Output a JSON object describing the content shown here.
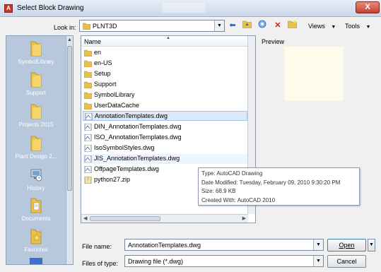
{
  "window": {
    "title": "Select Block Drawing",
    "close_glyph": "X"
  },
  "places": [
    {
      "label": "SymbolLibrary",
      "icon": "folder-icon"
    },
    {
      "label": "Support",
      "icon": "folder-icon"
    },
    {
      "label": "Projects 2015",
      "icon": "folder-icon"
    },
    {
      "label": "Plant Design 2...",
      "icon": "folder-icon"
    },
    {
      "label": "History",
      "icon": "history-icon"
    },
    {
      "label": "Documents",
      "icon": "documents-icon"
    },
    {
      "label": "Favorites",
      "icon": "favorites-icon"
    }
  ],
  "toolbar": {
    "look_in_label": "Look in:",
    "look_in_value": "PLNT3D",
    "views_label": "Views",
    "tools_label": "Tools"
  },
  "file_list": {
    "header": "Name",
    "items": [
      {
        "name": "en",
        "kind": "folder"
      },
      {
        "name": "en-US",
        "kind": "folder"
      },
      {
        "name": "Setup",
        "kind": "folder"
      },
      {
        "name": "Support",
        "kind": "folder"
      },
      {
        "name": "SymbolLibrary",
        "kind": "folder"
      },
      {
        "name": "UserDataCache",
        "kind": "folder"
      },
      {
        "name": "AnnotationTemplates.dwg",
        "kind": "dwg",
        "selected": true
      },
      {
        "name": "DIN_AnnotationTemplates.dwg",
        "kind": "dwg"
      },
      {
        "name": "ISO_AnnotationTemplates.dwg",
        "kind": "dwg"
      },
      {
        "name": "IsoSymbolStyles.dwg",
        "kind": "dwg"
      },
      {
        "name": "JIS_AnnotationTemplates.dwg",
        "kind": "dwg",
        "hover": true
      },
      {
        "name": "OffpageTemplates.dwg",
        "kind": "dwg"
      },
      {
        "name": "python27.zip",
        "kind": "zip"
      }
    ]
  },
  "tooltip": {
    "type": "Type: AutoCAD Drawing",
    "modified": "Date Modified: Tuesday, February 09, 2010 9:30:20 PM",
    "size": "Size: 68.9 KB",
    "created_with": "Created With: AutoCAD 2010"
  },
  "preview": {
    "label": "Preview"
  },
  "footer": {
    "file_name_label": "File name:",
    "file_name_value": "AnnotationTemplates.dwg",
    "files_of_type_label": "Files of type:",
    "files_of_type_value": "Drawing file (*.dwg)",
    "open_label": "Open",
    "cancel_label": "Cancel"
  },
  "colors": {
    "places_bg": "#b8c8dc",
    "folder_yellow": "#e8c04a",
    "selection": "#dbe9f8",
    "preview_bg": "#fdfbe9"
  }
}
